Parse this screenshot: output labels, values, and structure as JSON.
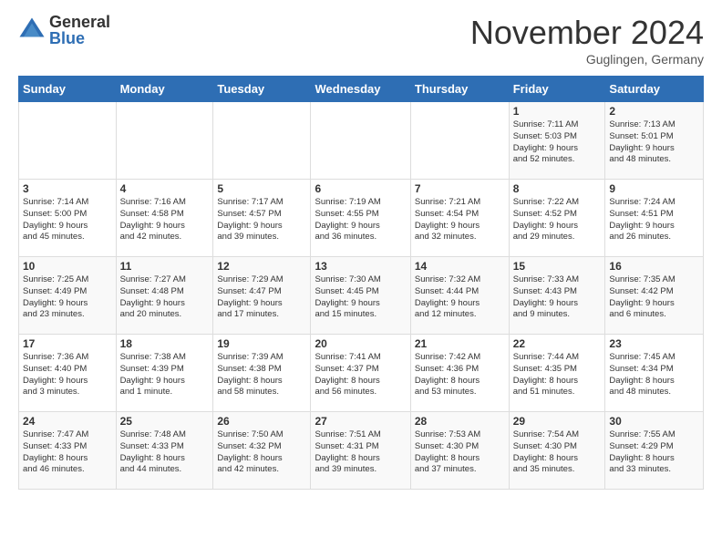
{
  "logo": {
    "general": "General",
    "blue": "Blue"
  },
  "header": {
    "month": "November 2024",
    "location": "Guglingen, Germany"
  },
  "weekdays": [
    "Sunday",
    "Monday",
    "Tuesday",
    "Wednesday",
    "Thursday",
    "Friday",
    "Saturday"
  ],
  "weeks": [
    [
      {
        "day": "",
        "info": ""
      },
      {
        "day": "",
        "info": ""
      },
      {
        "day": "",
        "info": ""
      },
      {
        "day": "",
        "info": ""
      },
      {
        "day": "",
        "info": ""
      },
      {
        "day": "1",
        "info": "Sunrise: 7:11 AM\nSunset: 5:03 PM\nDaylight: 9 hours\nand 52 minutes."
      },
      {
        "day": "2",
        "info": "Sunrise: 7:13 AM\nSunset: 5:01 PM\nDaylight: 9 hours\nand 48 minutes."
      }
    ],
    [
      {
        "day": "3",
        "info": "Sunrise: 7:14 AM\nSunset: 5:00 PM\nDaylight: 9 hours\nand 45 minutes."
      },
      {
        "day": "4",
        "info": "Sunrise: 7:16 AM\nSunset: 4:58 PM\nDaylight: 9 hours\nand 42 minutes."
      },
      {
        "day": "5",
        "info": "Sunrise: 7:17 AM\nSunset: 4:57 PM\nDaylight: 9 hours\nand 39 minutes."
      },
      {
        "day": "6",
        "info": "Sunrise: 7:19 AM\nSunset: 4:55 PM\nDaylight: 9 hours\nand 36 minutes."
      },
      {
        "day": "7",
        "info": "Sunrise: 7:21 AM\nSunset: 4:54 PM\nDaylight: 9 hours\nand 32 minutes."
      },
      {
        "day": "8",
        "info": "Sunrise: 7:22 AM\nSunset: 4:52 PM\nDaylight: 9 hours\nand 29 minutes."
      },
      {
        "day": "9",
        "info": "Sunrise: 7:24 AM\nSunset: 4:51 PM\nDaylight: 9 hours\nand 26 minutes."
      }
    ],
    [
      {
        "day": "10",
        "info": "Sunrise: 7:25 AM\nSunset: 4:49 PM\nDaylight: 9 hours\nand 23 minutes."
      },
      {
        "day": "11",
        "info": "Sunrise: 7:27 AM\nSunset: 4:48 PM\nDaylight: 9 hours\nand 20 minutes."
      },
      {
        "day": "12",
        "info": "Sunrise: 7:29 AM\nSunset: 4:47 PM\nDaylight: 9 hours\nand 17 minutes."
      },
      {
        "day": "13",
        "info": "Sunrise: 7:30 AM\nSunset: 4:45 PM\nDaylight: 9 hours\nand 15 minutes."
      },
      {
        "day": "14",
        "info": "Sunrise: 7:32 AM\nSunset: 4:44 PM\nDaylight: 9 hours\nand 12 minutes."
      },
      {
        "day": "15",
        "info": "Sunrise: 7:33 AM\nSunset: 4:43 PM\nDaylight: 9 hours\nand 9 minutes."
      },
      {
        "day": "16",
        "info": "Sunrise: 7:35 AM\nSunset: 4:42 PM\nDaylight: 9 hours\nand 6 minutes."
      }
    ],
    [
      {
        "day": "17",
        "info": "Sunrise: 7:36 AM\nSunset: 4:40 PM\nDaylight: 9 hours\nand 3 minutes."
      },
      {
        "day": "18",
        "info": "Sunrise: 7:38 AM\nSunset: 4:39 PM\nDaylight: 9 hours\nand 1 minute."
      },
      {
        "day": "19",
        "info": "Sunrise: 7:39 AM\nSunset: 4:38 PM\nDaylight: 8 hours\nand 58 minutes."
      },
      {
        "day": "20",
        "info": "Sunrise: 7:41 AM\nSunset: 4:37 PM\nDaylight: 8 hours\nand 56 minutes."
      },
      {
        "day": "21",
        "info": "Sunrise: 7:42 AM\nSunset: 4:36 PM\nDaylight: 8 hours\nand 53 minutes."
      },
      {
        "day": "22",
        "info": "Sunrise: 7:44 AM\nSunset: 4:35 PM\nDaylight: 8 hours\nand 51 minutes."
      },
      {
        "day": "23",
        "info": "Sunrise: 7:45 AM\nSunset: 4:34 PM\nDaylight: 8 hours\nand 48 minutes."
      }
    ],
    [
      {
        "day": "24",
        "info": "Sunrise: 7:47 AM\nSunset: 4:33 PM\nDaylight: 8 hours\nand 46 minutes."
      },
      {
        "day": "25",
        "info": "Sunrise: 7:48 AM\nSunset: 4:33 PM\nDaylight: 8 hours\nand 44 minutes."
      },
      {
        "day": "26",
        "info": "Sunrise: 7:50 AM\nSunset: 4:32 PM\nDaylight: 8 hours\nand 42 minutes."
      },
      {
        "day": "27",
        "info": "Sunrise: 7:51 AM\nSunset: 4:31 PM\nDaylight: 8 hours\nand 39 minutes."
      },
      {
        "day": "28",
        "info": "Sunrise: 7:53 AM\nSunset: 4:30 PM\nDaylight: 8 hours\nand 37 minutes."
      },
      {
        "day": "29",
        "info": "Sunrise: 7:54 AM\nSunset: 4:30 PM\nDaylight: 8 hours\nand 35 minutes."
      },
      {
        "day": "30",
        "info": "Sunrise: 7:55 AM\nSunset: 4:29 PM\nDaylight: 8 hours\nand 33 minutes."
      }
    ]
  ]
}
